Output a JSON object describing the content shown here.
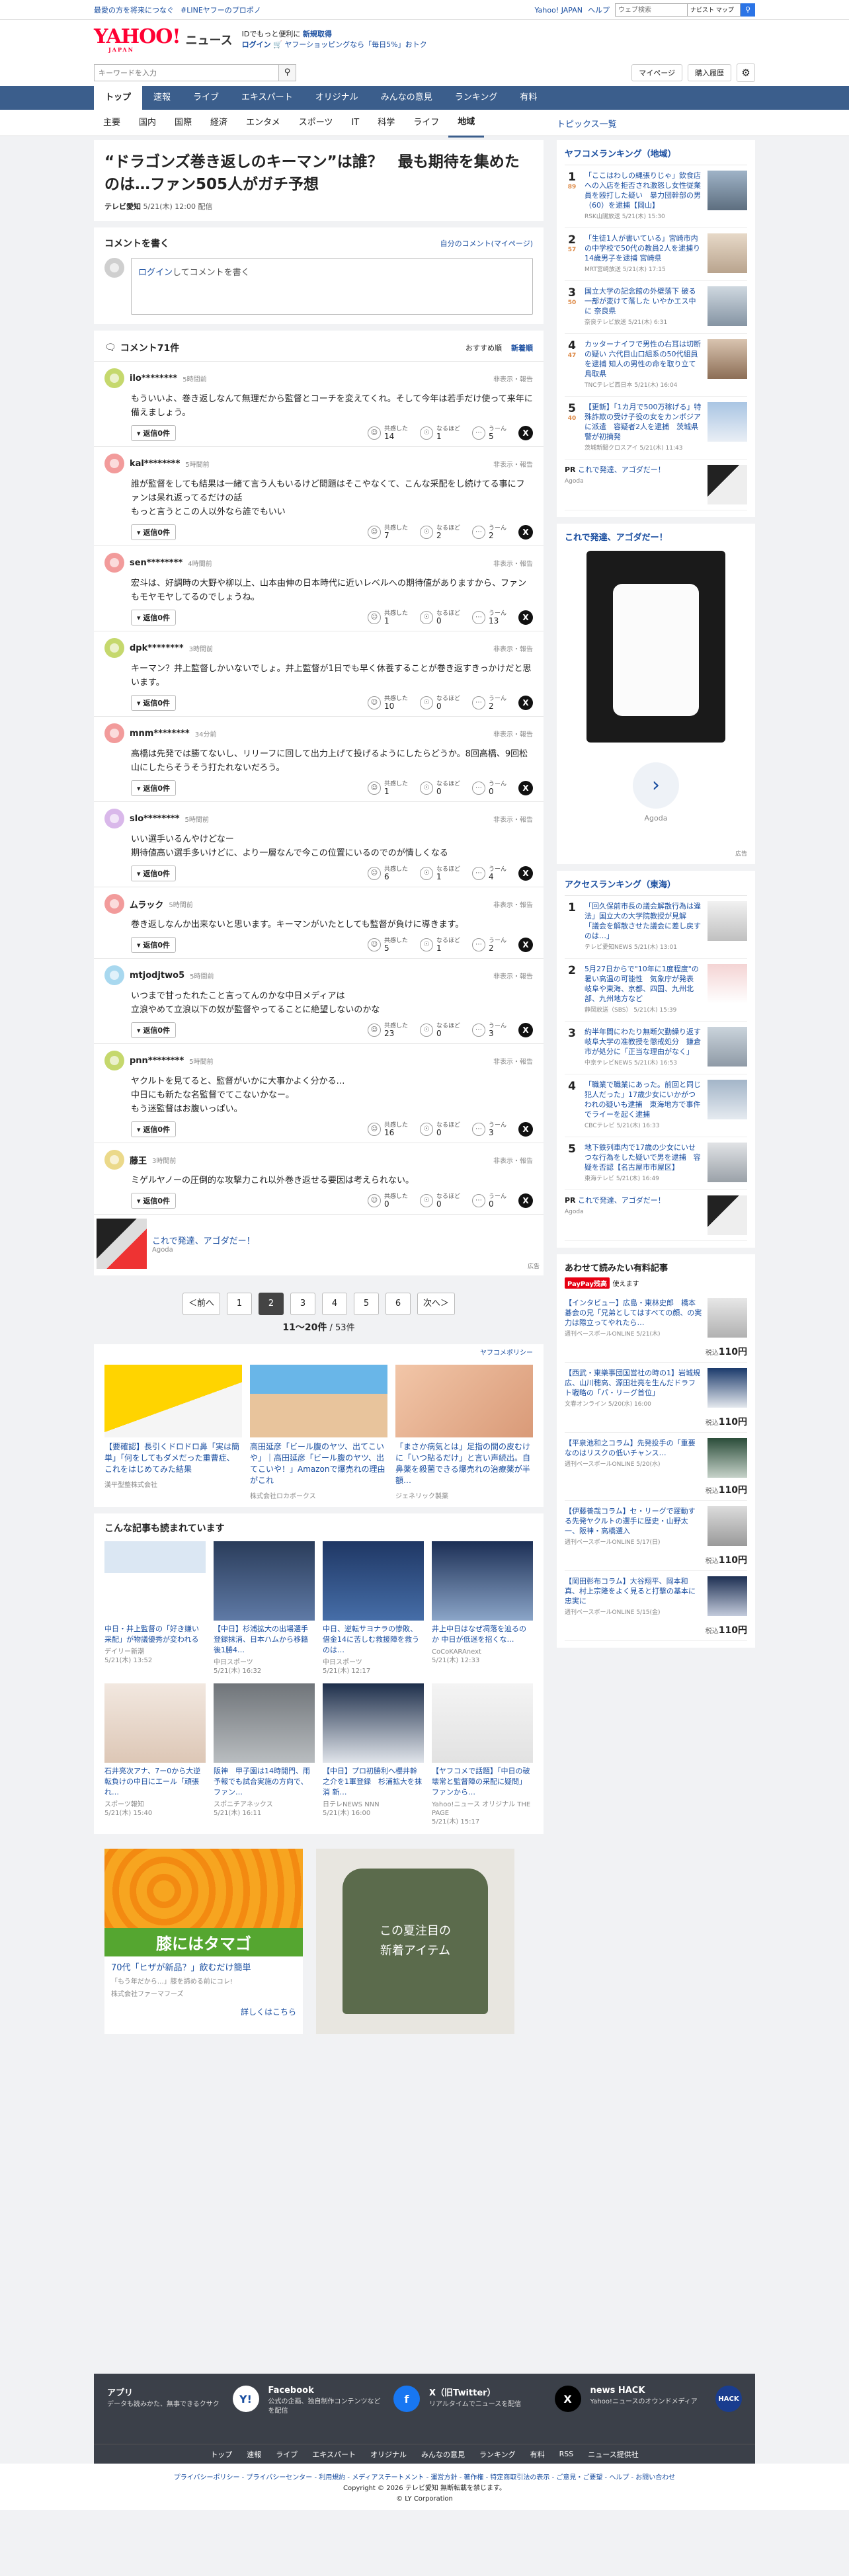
{
  "promo": {
    "left1": "最愛の方を将来につなぐ",
    "left2": "#LINEヤフーのプロポノ",
    "links": [
      "Yahoo! JAPAN",
      "ヘルプ"
    ],
    "search_placeholder": "ウェブ検索",
    "search_cat": "ナビスト マップ"
  },
  "header": {
    "logo": "YAHOO!",
    "logo_sub": "JAPAN",
    "section": "ニュース",
    "promo_line1_a": "IDでもっと便利に",
    "promo_line1_b": "新規取得",
    "promo_line2_a": "ログイン",
    "promo_line2_b": "ヤフーショッピングなら「毎日5%」おトク"
  },
  "search": {
    "placeholder": "キーワードを入力",
    "mypage": "マイページ",
    "purchase": "購入履歴"
  },
  "nav": {
    "items": [
      "トップ",
      "速報",
      "ライブ",
      "エキスパート",
      "オリジナル",
      "みんなの意見",
      "ランキング",
      "有料"
    ],
    "sub": [
      "主要",
      "国内",
      "国際",
      "経済",
      "エンタメ",
      "スポーツ",
      "IT",
      "科学",
      "ライフ",
      "地域"
    ],
    "topics": "トピックス一覧"
  },
  "article": {
    "title": "“ドラゴンズ巻き返しのキーマン”は誰？　最も期待を集めたのは…ファン505人がガチ予想",
    "source": "テレビ愛知",
    "date": "5/21(木) 12:00 配信"
  },
  "compose": {
    "heading": "コメントを書く",
    "mine": "自分のコメント(マイページ)",
    "login": "ログイン",
    "placeholder": "してコメントを書く"
  },
  "comments": {
    "count_label": "コメント71件",
    "sort_recommend": "おすすめ順",
    "sort_new": "新着順",
    "reply_label": "返信0件",
    "report": "非表示・報告",
    "r1": "共感した",
    "r2": "なるほど",
    "r3": "うーん",
    "items": [
      {
        "user": "ilo********",
        "ago": "5時間前",
        "text": "もういいよ、巻き返しなんて無理だから監督とコーチを変えてくれ。そして今年は若手だけ使って来年に備えましょう。",
        "a": "14",
        "b": "1",
        "c": "5",
        "color": "#c5d86d"
      },
      {
        "user": "kal********",
        "ago": "5時間前",
        "text": "誰が監督をしても結果は一緒て言う人もいるけど問題はそこやなくて、こんな采配をし続けてる事にファンは呆れ返ってるだけの話\nもっと言うとこの人以外なら誰でもいい",
        "a": "7",
        "b": "2",
        "c": "2",
        "color": "#f29b9b"
      },
      {
        "user": "sen********",
        "ago": "4時間前",
        "text": "宏斗は、好調時の大野や柳以上、山本由伸の日本時代に近いレベルへの期待値がありますから、ファンもモヤモヤしてるのでしょうね。",
        "a": "1",
        "b": "0",
        "c": "13",
        "color": "#f29b9b"
      },
      {
        "user": "dpk********",
        "ago": "3時間前",
        "text": "キーマン？井上監督しかいないでしょ。井上監督が1日でも早く休養することが巻き返すきっかけだと思います。",
        "a": "10",
        "b": "0",
        "c": "2",
        "color": "#c5d86d"
      },
      {
        "user": "mnm********",
        "ago": "34分前",
        "text": "高橋は先発では勝てないし、リリーフに回して出力上げて投げるようにしたらどうか。8回高橋、9回松山にしたらそうそう打たれないだろう。",
        "a": "1",
        "b": "0",
        "c": "0",
        "color": "#f29b9b"
      },
      {
        "user": "slo********",
        "ago": "5時間前",
        "text": "いい選手いるんやけどなー\n期待値高い選手多いけどに、より一層なんで今この位置にいるのでのが情しくなる",
        "a": "6",
        "b": "1",
        "c": "4",
        "color": "#d9b8ea"
      },
      {
        "user": "ムラック",
        "ago": "5時間前",
        "text": "巻き返しなんか出来ないと思います。キーマンがいたとしても監督が負けに導きます。",
        "a": "5",
        "b": "1",
        "c": "2",
        "color": "#f29b9b"
      },
      {
        "user": "mtjodjtwo5",
        "ago": "5時間前",
        "text": "いつまで甘ったれたこと言ってんのかな中日メディアは\n立浪やめて立浪以下の奴が監督やってることに絶望しないのかな",
        "a": "23",
        "b": "0",
        "c": "3",
        "color": "#a8d8ef"
      },
      {
        "user": "pnn********",
        "ago": "5時間前",
        "text": "ヤクルトを見てると、監督がいかに大事かよく分かる…\n中日にも新たな名監督でてこないかなー。\nもう迷監督はお腹いっぱい。",
        "a": "16",
        "b": "0",
        "c": "3",
        "color": "#c5d86d"
      },
      {
        "user": "藤王",
        "ago": "3時間前",
        "text": "ミゲルヤノーの圧倒的な攻撃力これ以外巻き返せる要因は考えられない。",
        "a": "0",
        "b": "0",
        "c": "0",
        "color": "#ebd98a"
      }
    ]
  },
  "inline_ad": {
    "title": "これで発達、アゴダだー！",
    "sponsor": "Agoda",
    "mark": "広告"
  },
  "pager": {
    "prev": "＜前へ",
    "pages": [
      "1",
      "2",
      "3",
      "4",
      "5",
      "6"
    ],
    "next": "次へ＞",
    "range": "11〜20件",
    "total": "/ 53件"
  },
  "policy": "ヤフコメポリシー",
  "ads3": [
    {
      "title": "【要確認】長引くドロドロ鼻「実は簡単」「何をしてもダメだった重曹症、これをはじめてみた結果",
      "sponsor": "漢平型整株式会社",
      "bg": "linear-gradient(160deg,#ffd400 55%,#f5f5f5 55%)"
    },
    {
      "title": "高田延彦「ビール腹のヤツ、出てこいや」｜高田延彦「ビール腹のヤツ、出てこいや！」Amazonで爆売れの理由がこれ",
      "sponsor": "株式会社ロカボークス",
      "bg": "linear-gradient(180deg,#69b6e8 40%,#e8c49c 40%)"
    },
    {
      "title": "「まさか病気とは」足指の間の皮むけに「いつ貼るだけ」と言い声続出。自鼻薬を殺菌できる爆売れの治療薬が半額…",
      "sponsor": "ジェネリック製薬",
      "bg": "linear-gradient(135deg,#f2c6a8,#d99a78)"
    }
  ],
  "related": {
    "heading": "こんな記事も読まれています",
    "items": [
      {
        "title": "中日・井上監督の「好き嫌い采配」が物議優秀が変われる",
        "src": "デイリー新潮",
        "date": "5/21(木) 13:52",
        "bg": "linear-gradient(#dbe7f3 40%,#fff 40%)"
      },
      {
        "title": "【中日】杉浦拡大の出場選手登録抹消、日本ハムから移籍後1勝4…",
        "src": "中日スポーツ",
        "date": "5/21(木) 16:32",
        "bg": "linear-gradient(#2a3c5a,#5f7aa6)"
      },
      {
        "title": "中日、逆転サヨナラの惨敗、借金14に苦しむ救援陣を救うのは…",
        "src": "中日スポーツ",
        "date": "5/21(木) 12:17",
        "bg": "linear-gradient(#1f3764,#466ea8)"
      },
      {
        "title": "井上中日はなぜ凋落を辿るのか 中日が低迷を招くな…",
        "src": "CoCoKARAnext",
        "date": "5/21(木) 12:33",
        "bg": "linear-gradient(#1c2f55,#8ba5c8)"
      },
      {
        "title": "石井亮次アナ、7ー0から大逆転負けの中日にエール「頑張れ…",
        "src": "スポーツ報知",
        "date": "5/21(木) 15:40",
        "bg": "linear-gradient(#f2e8e0,#ddc7b6)"
      },
      {
        "title": "阪神　甲子園は14時開門、雨予報でも試合実施の方向で、ファン…",
        "src": "スポニチアネックス",
        "date": "5/21(木) 16:11",
        "bg": "linear-gradient(#6f7479,#b9bdc0)"
      },
      {
        "title": "【中日】プロ初勝利へ櫻井幹之介を1軍登録　杉浦拡大を抹消 新…",
        "src": "日テレNEWS NNN",
        "date": "5/21(木) 16:00",
        "bg": "linear-gradient(#1d2e4a,#e0e4ea)"
      },
      {
        "title": "【ヤフコメで話題】「中日の破壊常と監督陣の采配に疑問」ファンから…",
        "src": "Yahoo!ニュース オリジナル THE PAGE",
        "date": "5/21(木) 15:17",
        "bg": "linear-gradient(#f4f4f4,#e2e2e2)"
      }
    ]
  },
  "big_ads": {
    "band": "膝にはタマゴ",
    "title": "70代「ヒザが新品？」飲むだけ簡単",
    "desc": "「もう年だから…」膝を諦める前にコレ!",
    "sponsor": "株式会社ファーマフーズ",
    "more": "詳しくはこちら",
    "shirt_line1": "この夏注目の",
    "shirt_line2": "新着アイテム",
    "mark": "広告"
  },
  "yahoo_rank": {
    "heading": "ヤフコメランキング（地域）",
    "items": [
      {
        "title": "「ここはわしの縄張りじゃ」飲食店への入店を拒否され激怒し女性従業員を殴打した疑い　暴力団幹部の男（60）を逮捕【岡山】",
        "src": "RSK山陽放送 5/21(木) 15:30",
        "cnt": "89",
        "bg": "linear-gradient(#9fb3c7,#5d6e7f)"
      },
      {
        "title": "「生徒1人が書いている」宮崎市内の中学校で50代の教員2人を逮捕り 14歳男子を逮捕 宮崎県",
        "src": "MRT宮崎放送 5/21(木) 17:15",
        "cnt": "57",
        "bg": "linear-gradient(#e7d9c8,#b9a48e)"
      },
      {
        "title": "国立大学の記念館の外壁落下 破る一部が変けて落した いやかエス中に 奈良県",
        "src": "奈良テレビ放送 5/21(木) 6:31",
        "cnt": "50",
        "bg": "linear-gradient(#cfd8e0,#8594a3)"
      },
      {
        "title": "カッターナイフで男性の右耳は切断の疑い 六代目山口組系の50代組員を逮捕 知人の男性の命を取り立て 鳥取県",
        "src": "TNCテレビ西日本 5/21(木) 16:04",
        "cnt": "47",
        "bg": "linear-gradient(#d9c4b0,#8c6e56)"
      },
      {
        "title": "【更新】「1カ月で500万稼げる」特殊詐欺の受け子役の女をカンボジアに派遣　容疑者2人を逮捕　茨城県警が初摘発",
        "src": "茨城新聞クロスアイ 5/21(木) 11:43",
        "cnt": "40",
        "bg": "linear-gradient(#a9c5e3,#e9eef5)"
      }
    ],
    "pr_label": "PR",
    "pr_title": "これで発達、アゴダだー！",
    "pr_src": "Agoda"
  },
  "right_ad": {
    "title": "これで発達、アゴダだー！",
    "sponsor": "Agoda",
    "mark": "広告"
  },
  "access_rank": {
    "heading": "アクセスランキング（東海）",
    "items": [
      {
        "title": "「回久保前市長の議会解散行為は違法」国立大の大学院教授が見解 「議会を解散させた議会に差し戻すのは…」",
        "src": "テレビ愛知NEWS 5/21(木) 13:01",
        "bg": "linear-gradient(#f1f1f1,#c0c0c0)"
      },
      {
        "title": "5月27日からで\"10年に1度程度\"の暑い高温の可能性　気象庁が発表　岐阜や東海、京都、四国、九州北部、九州地方など",
        "src": "静岡放送（SBS） 5/21(木) 15:39",
        "bg": "linear-gradient(#f4d4d4,#ffffff)"
      },
      {
        "title": "約半年間にわたり無断欠勤繰り返す　岐阜大学の准教授を懲戒処分　鎌倉市が処分に「正当な理由がなく」",
        "src": "中京テレビNEWS 5/21(木) 16:53",
        "bg": "linear-gradient(#cbd4dc,#8f9aa6)"
      },
      {
        "title": "「職業で職業にあった。前回と同じ犯人だった」17歳少女にいかがつわれの疑いも逮捕　東海地方で事件でライーを起く逮捕",
        "src": "CBCテレビ 5/21(木) 16:33",
        "bg": "linear-gradient(#a3b5c8,#e5eaf0)"
      },
      {
        "title": "地下鉄列車内で17歳の少女にいせつな行為をした疑いで男を逮捕　容疑を否認【名古屋市市屋区】",
        "src": "東海テレビ 5/21(木) 16:49",
        "bg": "linear-gradient(#e1e3e6,#9aa1a8)"
      }
    ],
    "pr_label": "PR",
    "pr_title": "これで発達、アゴダだー！",
    "pr_src": "Agoda"
  },
  "paid": {
    "heading": "あわせて読みたい有料記事",
    "badge": "PayPay残高",
    "badge_suffix": "使えます",
    "price_prefix": "税込",
    "items": [
      {
        "title": "【インタビュー】広島・東林史郎　橋本碁会の兄「兄弟としてはすべての顔、の実力は際立ってやれたら…",
        "src": "週刊ベースボールONLINE 5/21(木)",
        "price": "110円",
        "bg": "linear-gradient(#e7e7e7,#b1b1b1)"
      },
      {
        "title": "【西武・東樂事団国営社の時の1】岩城規広、山川穂高、源田壮亮を生んだドラフト戦略の「パ・リーグ首位」",
        "src": "文春オンライン 5/20(水) 16:00",
        "price": "110円",
        "bg": "linear-gradient(#1b3a6b,#e4e8ee)"
      },
      {
        "title": "【平泉池和之コラム】先発投手の「重要なのはリスクの低いチャンス…",
        "src": "週刊ベースボールONLINE 5/20(水)",
        "price": "110円",
        "bg": "linear-gradient(#2b4d3a,#c6d2c9)"
      },
      {
        "title": "【伊藤善哉コラム】セ・リーグで躍動する先発ヤクルトの選手に歴史・山野太一、阪神・高橋選入",
        "src": "週刊ベースボールONLINE 5/17(日)",
        "price": "110円",
        "bg": "linear-gradient(#dcdcdc,#9a9a9a)"
      },
      {
        "title": "【岡田彰布コラム】大谷翔平、岡本和真、村上宗隆をよく見ると打撃の基本に忠実に",
        "src": "週刊ベースボールONLINE 5/15(金)",
        "price": "110円",
        "bg": "linear-gradient(#1d2f52,#c2cadb)"
      }
    ]
  },
  "footer": {
    "apps": [
      {
        "title": "アプリ",
        "desc": "データも読みかた、無事できるクサク",
        "icon": "Y!",
        "icon_bg": "#ffffff",
        "icon_fg": "#1a4ea0"
      },
      {
        "title": "Facebook",
        "desc": "公式の企画、独自制作コンテンツなどを配信",
        "icon": "f",
        "icon_bg": "#1877f2",
        "icon_fg": "#ffffff"
      },
      {
        "title": "X（旧Twitter）",
        "desc": "リアルタイムでニュースを配信",
        "icon": "X",
        "icon_bg": "#000000",
        "icon_fg": "#ffffff"
      },
      {
        "title": "news HACK",
        "desc": "Yahoo!ニュースのオウンドメディア",
        "icon": "HACK",
        "icon_bg": "#1a3d8f",
        "icon_fg": "#ffffff"
      }
    ],
    "nav": [
      "トップ",
      "速報",
      "ライブ",
      "エキスパート",
      "オリジナル",
      "みんなの意見",
      "ランキング",
      "有料",
      "RSS",
      "ニュース提供社"
    ],
    "links": "プライバシーポリシー - プライバシーセンター - 利用規約 - メディアステートメント - 運営方針 - 著作権 - 特定商取引法の表示 - ご意見・ご要望 - ヘルプ - お問い合わせ",
    "copy1": "Copyright © 2026 テレビ愛知 無断転載を禁じます。",
    "copy2": "© LY Corporation"
  }
}
